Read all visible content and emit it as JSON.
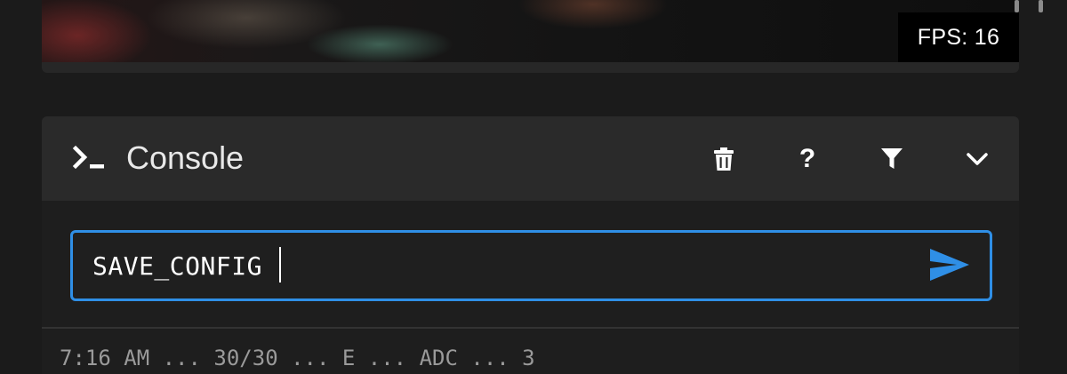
{
  "camera": {
    "fps_label": "FPS: 16"
  },
  "console": {
    "title": "Console",
    "icons": {
      "prompt": "terminal-prompt-icon",
      "clear": "trash-icon",
      "help": "help-icon",
      "filter": "filter-icon",
      "collapse": "chevron-down-icon",
      "send": "send-icon"
    },
    "help_glyph": "?",
    "input": {
      "value": "SAVE_CONFIG",
      "placeholder": ""
    },
    "log_preview": "7:16 AM  ...  30/30 ... E ... ADC ... 3"
  },
  "colors": {
    "accent": "#2f8fe6",
    "background": "#1b1b1b",
    "card": "#2a2a2a"
  }
}
